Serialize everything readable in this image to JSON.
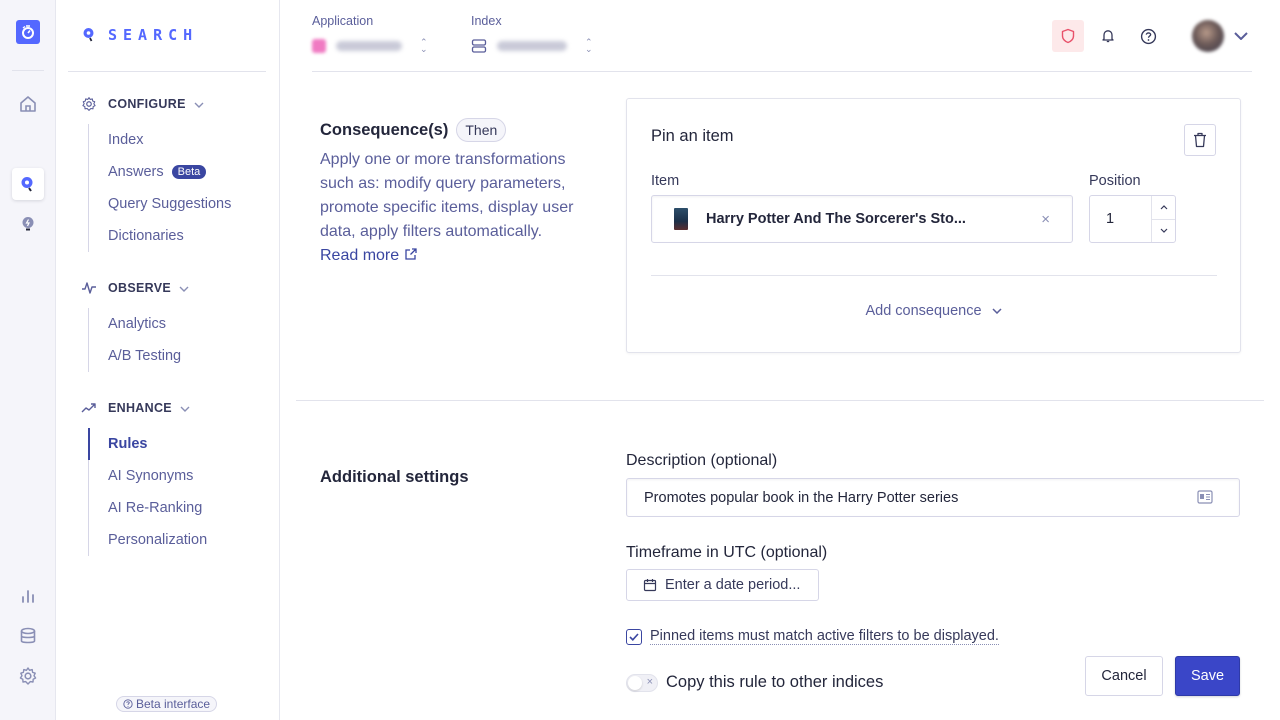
{
  "brand": {
    "name": "SEARCH",
    "color": "#5468ff"
  },
  "rail": {
    "items": [
      {
        "icon": "algolia-logo-icon"
      },
      {
        "icon": "home-icon"
      },
      {
        "icon": "search-product-icon",
        "active": true
      },
      {
        "icon": "recommend-bulb-icon"
      },
      {
        "icon": "analytics-chart-icon"
      },
      {
        "icon": "database-icon"
      },
      {
        "icon": "settings-gear-icon"
      }
    ]
  },
  "sidebar": {
    "sections": [
      {
        "title": "CONFIGURE",
        "icon": "gear-icon",
        "items": [
          {
            "label": "Index"
          },
          {
            "label": "Answers",
            "badge": "Beta"
          },
          {
            "label": "Query Suggestions"
          },
          {
            "label": "Dictionaries"
          }
        ]
      },
      {
        "title": "OBSERVE",
        "icon": "pulse-icon",
        "items": [
          {
            "label": "Analytics"
          },
          {
            "label": "A/B Testing"
          }
        ]
      },
      {
        "title": "ENHANCE",
        "icon": "trending-up-icon",
        "items": [
          {
            "label": "Rules",
            "active": true
          },
          {
            "label": "AI Synonyms"
          },
          {
            "label": "AI Re-Ranking"
          },
          {
            "label": "Personalization"
          }
        ]
      }
    ],
    "beta_interface": "Beta interface"
  },
  "topbar": {
    "application_label": "Application",
    "index_label": "Index",
    "icons": [
      "shield-icon",
      "bell-icon",
      "help-icon",
      "avatar",
      "chevron-down-icon"
    ]
  },
  "consequences": {
    "title": "Consequence(s)",
    "pill": "Then",
    "description": "Apply one or more transformations such as: modify query parameters, promote specific items, display user data, apply filters automatically.",
    "read_more": "Read more",
    "card": {
      "title": "Pin an item",
      "item_label": "Item",
      "item_value": "Harry Potter And The Sorcerer's Sto...",
      "position_label": "Position",
      "position_value": "1",
      "add_consequence": "Add consequence"
    }
  },
  "additional": {
    "title": "Additional settings",
    "description_label": "Description (optional)",
    "description_value": "Promotes popular book in the Harry Potter series",
    "timeframe_label": "Timeframe in UTC (optional)",
    "timeframe_placeholder": "Enter a date period...",
    "pinned_filter_label": "Pinned items must match active filters to be displayed.",
    "pinned_filter_checked": true,
    "copy_rule_label": "Copy this rule to other indices",
    "copy_rule_enabled": false
  },
  "actions": {
    "cancel": "Cancel",
    "save": "Save",
    "save_color": "#3a46c8"
  }
}
